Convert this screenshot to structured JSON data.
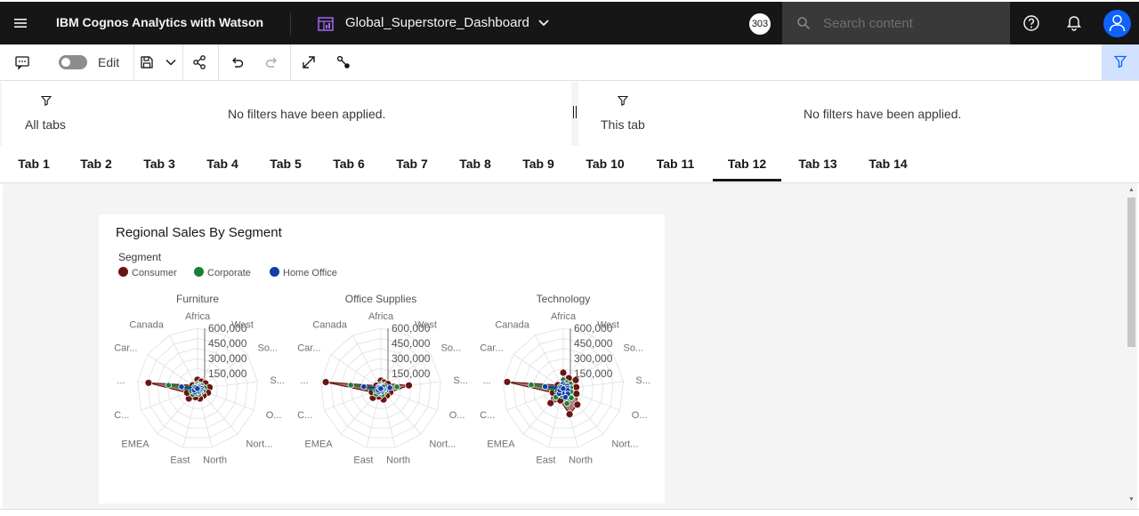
{
  "header": {
    "app_title": "IBM Cognos Analytics with Watson",
    "dashboard_title": "Global_Superstore_Dashboard",
    "badge_count": "303",
    "search_placeholder": "Search content"
  },
  "toolbar": {
    "edit_label": "Edit",
    "edit_mode_on": false
  },
  "filters": {
    "all_tabs_label": "All tabs",
    "all_tabs_message": "No filters have been applied.",
    "this_tab_label": "This tab",
    "this_tab_message": "No filters have been applied."
  },
  "tabs": [
    {
      "label": "Tab 1"
    },
    {
      "label": "Tab 2"
    },
    {
      "label": "Tab 3"
    },
    {
      "label": "Tab 4"
    },
    {
      "label": "Tab 5"
    },
    {
      "label": "Tab 6"
    },
    {
      "label": "Tab 7"
    },
    {
      "label": "Tab 8"
    },
    {
      "label": "Tab 9"
    },
    {
      "label": "Tab 10"
    },
    {
      "label": "Tab 11"
    },
    {
      "label": "Tab 12"
    },
    {
      "label": "Tab 13"
    },
    {
      "label": "Tab 14"
    }
  ],
  "active_tab": "Tab 12",
  "widget": {
    "title": "Regional Sales By Segment",
    "legend_title": "Segment"
  },
  "colors": {
    "Consumer": "#6b1414",
    "Corporate": "#198038",
    "Home Office": "#0f3fa8",
    "accent": "#0f62fe"
  },
  "chart_data": {
    "type": "radar",
    "legend_title": "Segment",
    "series_names": [
      "Consumer",
      "Corporate",
      "Home Office"
    ],
    "axes": [
      "Africa",
      "West",
      "So...",
      "S...",
      "O...",
      "Nort...",
      "North",
      "East",
      "EMEA",
      "C...",
      "...",
      "Car...",
      "Canada"
    ],
    "radial_ticks": [
      150000,
      300000,
      450000,
      600000
    ],
    "radial_tick_labels": [
      "150,000",
      "300,000",
      "450,000",
      "600,000"
    ],
    "rmax": 600000,
    "panels": [
      {
        "title": "Furniture",
        "series": [
          {
            "name": "Consumer",
            "values": [
              90000,
              80000,
              95000,
              120000,
              110000,
              90000,
              100000,
              85000,
              130000,
              110000,
              490000,
              60000,
              5000
            ]
          },
          {
            "name": "Corporate",
            "values": [
              50000,
              45000,
              55000,
              70000,
              60000,
              50000,
              55000,
              50000,
              75000,
              65000,
              290000,
              35000,
              3000
            ]
          },
          {
            "name": "Home Office",
            "values": [
              30000,
              25000,
              30000,
              40000,
              35000,
              28000,
              32000,
              27000,
              42000,
              36000,
              160000,
              20000,
              2000
            ]
          }
        ]
      },
      {
        "title": "Office Supplies",
        "series": [
          {
            "name": "Consumer",
            "values": [
              80000,
              70000,
              85000,
              280000,
              100000,
              90000,
              110000,
              80000,
              120000,
              95000,
              550000,
              55000,
              4000
            ]
          },
          {
            "name": "Corporate",
            "values": [
              45000,
              40000,
              50000,
              160000,
              55000,
              50000,
              60000,
              45000,
              70000,
              55000,
              300000,
              30000,
              2500
            ]
          },
          {
            "name": "Home Office",
            "values": [
              25000,
              22000,
              28000,
              90000,
              30000,
              27000,
              33000,
              25000,
              38000,
              30000,
              170000,
              17000,
              1500
            ]
          }
        ]
      },
      {
        "title": "Technology",
        "series": [
          {
            "name": "Consumer",
            "values": [
              160000,
              120000,
              150000,
              130000,
              140000,
              210000,
              260000,
              120000,
              190000,
              110000,
              560000,
              65000,
              5000
            ]
          },
          {
            "name": "Corporate",
            "values": [
              90000,
              70000,
              85000,
              75000,
              80000,
              120000,
              150000,
              70000,
              110000,
              65000,
              320000,
              38000,
              3000
            ]
          },
          {
            "name": "Home Office",
            "values": [
              50000,
              40000,
              48000,
              42000,
              46000,
              68000,
              85000,
              40000,
              62000,
              37000,
              180000,
              22000,
              2000
            ]
          }
        ]
      }
    ]
  }
}
